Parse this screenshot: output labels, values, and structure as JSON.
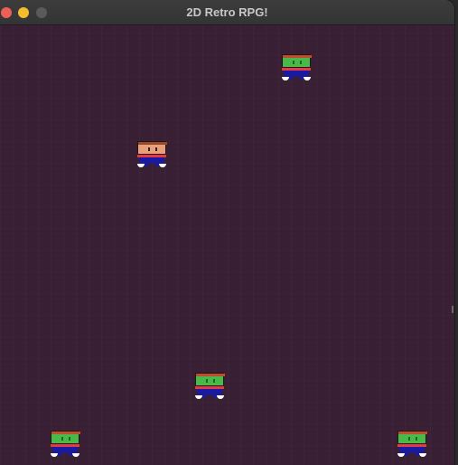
{
  "window": {
    "title": "2D Retro RPG!",
    "background_color": "#3a2035"
  },
  "titlebar_buttons": [
    "close",
    "minimize",
    "maximize"
  ],
  "player": {
    "kind": "hero",
    "skin_color": "#e9a07a",
    "clothing_color": "#1a1aa0",
    "belt_color": "#e8354a"
  },
  "enemies": [
    {
      "kind": "green-goblin"
    },
    {
      "kind": "green-goblin"
    },
    {
      "kind": "green-goblin"
    },
    {
      "kind": "green-goblin"
    }
  ],
  "enemy_colors": {
    "skin": "#4bb84b",
    "clothing": "#1a1aa0",
    "belt": "#e8354a"
  }
}
